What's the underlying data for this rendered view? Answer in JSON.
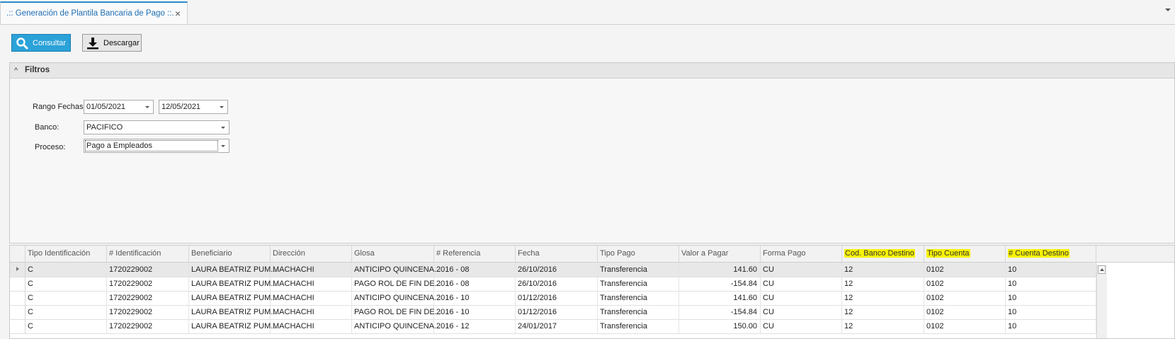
{
  "tab": {
    "title": ".:: Generación de Plantila Bancaria de Pago ::.",
    "close": "×"
  },
  "toolbar": {
    "consultar_label": "Consultar",
    "descargar_label": "Descargar"
  },
  "filters": {
    "title": "Filtros",
    "rango_fechas_label": "Rango Fechas",
    "fecha_desde": "01/05/2021",
    "fecha_hasta": "12/05/2021",
    "banco_label": "Banco:",
    "banco_value": "PACIFICO",
    "proceso_label": "Proceso:",
    "proceso_value": "Pago a Empleados"
  },
  "grid": {
    "columns": [
      "Tipo Identificación",
      "# Identificación",
      "Beneficiario",
      "Dirección",
      "Glosa",
      "# Referencia",
      "Fecha",
      "Tipo Pago",
      "Valor a Pagar",
      "Forma Pago",
      "Cod. Banco Destino",
      "Tipo Cuenta",
      "# Cuenta Destino"
    ],
    "highlight_color": "#f7f200",
    "rows": [
      [
        "C",
        "1720229002",
        "LAURA BEATRIZ PUM...",
        "MACHACHI",
        "ANTICIPO QUINCENA...",
        "2016 - 08",
        "26/10/2016",
        "Transferencia",
        "141.60",
        "CU",
        "12",
        "0102",
        "10"
      ],
      [
        "C",
        "1720229002",
        "LAURA BEATRIZ PUM...",
        "MACHACHI",
        "PAGO ROL DE FIN DE...",
        "2016 - 08",
        "26/10/2016",
        "Transferencia",
        "-154.84",
        "CU",
        "12",
        "0102",
        "10"
      ],
      [
        "C",
        "1720229002",
        "LAURA BEATRIZ PUM...",
        "MACHACHI",
        "ANTICIPO QUINCENA...",
        "2016 - 10",
        "01/12/2016",
        "Transferencia",
        "141.60",
        "CU",
        "12",
        "0102",
        "10"
      ],
      [
        "C",
        "1720229002",
        "LAURA BEATRIZ PUM...",
        "MACHACHI",
        "PAGO ROL DE FIN DE...",
        "2016 - 10",
        "01/12/2016",
        "Transferencia",
        "-154.84",
        "CU",
        "12",
        "0102",
        "10"
      ],
      [
        "C",
        "1720229002",
        "LAURA BEATRIZ PUM...",
        "MACHACHI",
        "ANTICIPO QUINCENA...",
        "2016 - 12",
        "24/01/2017",
        "Transferencia",
        "150.00",
        "CU",
        "12",
        "0102",
        "10"
      ]
    ]
  }
}
